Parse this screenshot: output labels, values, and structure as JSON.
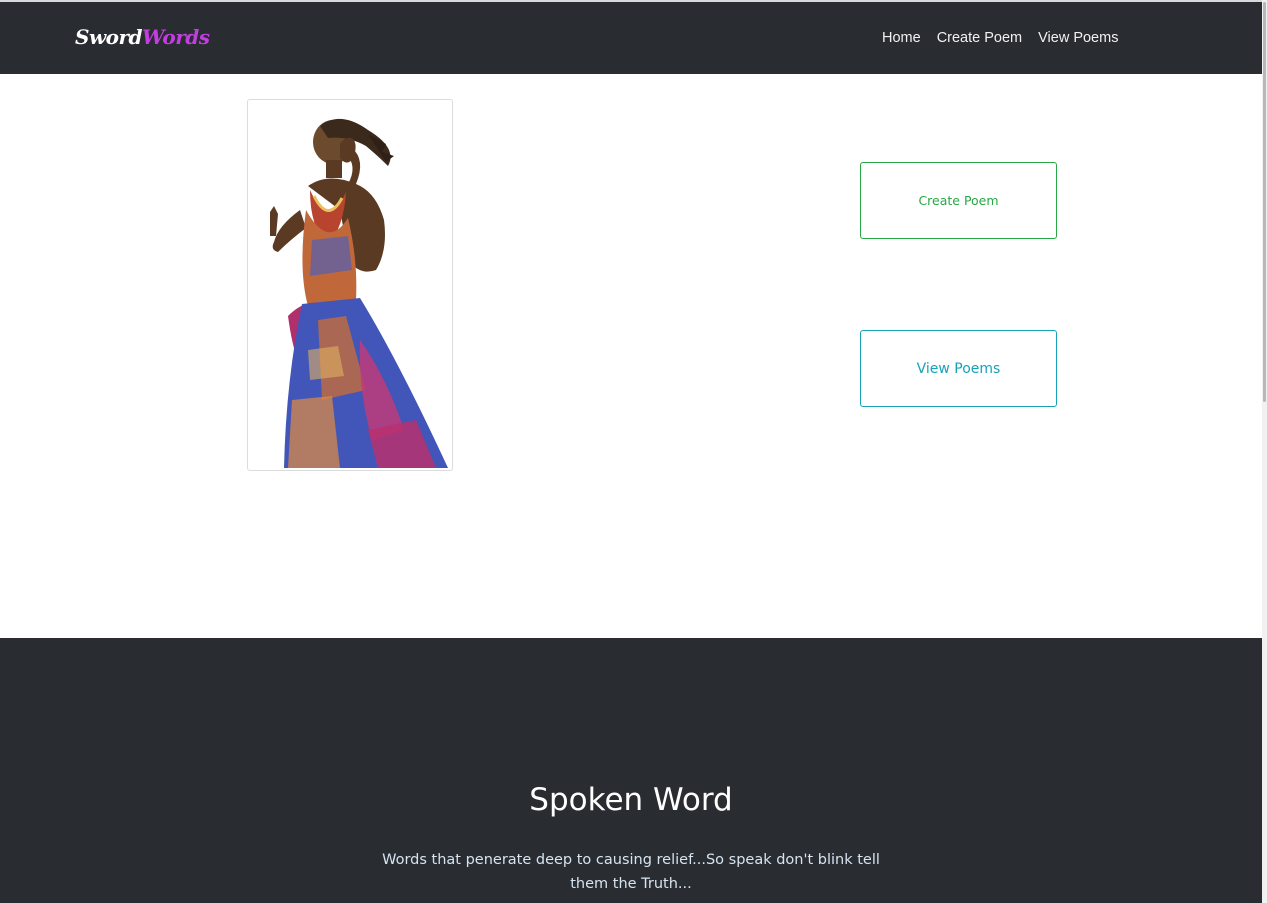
{
  "navbar": {
    "brand_part1": "Sword",
    "brand_part2": "Words",
    "links": [
      {
        "label": "Home"
      },
      {
        "label": "Create Poem"
      },
      {
        "label": "View Poems"
      }
    ]
  },
  "hero": {
    "create_button_label": "Create Poem",
    "view_button_label": "View Poems",
    "image_subject": "spoken-word-performer-photo"
  },
  "section": {
    "title": "Spoken Word",
    "text": "Words that penerate deep to causing relief...So speak don't blink tell them the Truth..."
  },
  "colors": {
    "navbar_bg": "#292c30",
    "brand_accent": "#c33ee0",
    "create_button": "#28a745",
    "view_button": "#17a2b8"
  }
}
